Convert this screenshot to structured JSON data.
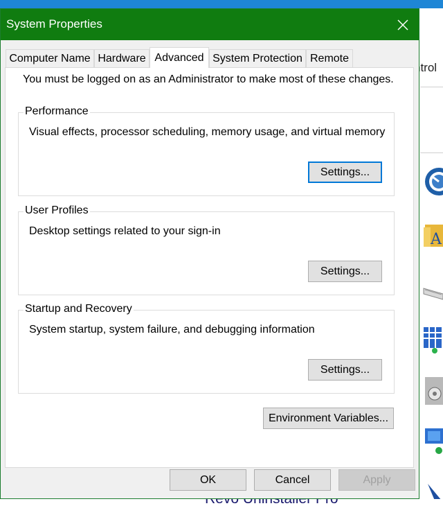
{
  "window": {
    "title": "System Properties",
    "close_label": "close"
  },
  "tabs": [
    {
      "label": "Computer Name",
      "active": false
    },
    {
      "label": "Hardware",
      "active": false
    },
    {
      "label": "Advanced",
      "active": true
    },
    {
      "label": "System Protection",
      "active": false
    },
    {
      "label": "Remote",
      "active": false
    }
  ],
  "admin_note": "You must be logged on as an Administrator to make most of these changes.",
  "groups": [
    {
      "title": "Performance",
      "description": "Visual effects, processor scheduling, memory usage, and virtual memory",
      "button": "Settings..."
    },
    {
      "title": "User Profiles",
      "description": "Desktop settings related to your sign-in",
      "button": "Settings..."
    },
    {
      "title": "Startup and Recovery",
      "description": "System startup, system failure, and debugging information",
      "button": "Settings..."
    }
  ],
  "env_button": "Environment Variables...",
  "footer": {
    "ok": "OK",
    "cancel": "Cancel",
    "apply": "Apply"
  },
  "background": {
    "partial_text": "ntrol",
    "bottom_text": "Revo Uninstaller Pro",
    "icons": [
      "settings-gauge-icon",
      "folder-icon",
      "keyboard-icon",
      "network-icon",
      "disc-drive-icon",
      "remote-desktop-icon"
    ]
  },
  "colors": {
    "titlebar": "#107c10",
    "focus_border": "#0078d7",
    "desktop_blue": "#1e86d6"
  }
}
